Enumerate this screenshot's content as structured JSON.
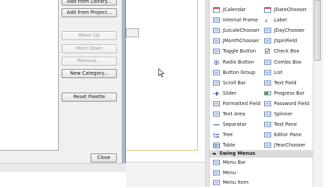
{
  "dialog": {
    "buttons": {
      "add_from_library": "Add from Library...",
      "add_from_project": "Add from Project...",
      "move_up": "Move Up",
      "move_down": "More Down",
      "remove": "Remove...",
      "new_category": "New Category...",
      "reset_palette": "Reset Palette",
      "close": "Close"
    }
  },
  "palette": {
    "items_left": [
      {
        "label": "JCalendar",
        "icon": "calendar-icon"
      },
      {
        "label": "Internal Frame",
        "icon": "internal-frame-icon"
      },
      {
        "label": "JLocaleChooser",
        "icon": "locale-chooser-icon"
      },
      {
        "label": "JMonthChooser",
        "icon": "month-chooser-icon"
      },
      {
        "label": "Toggle Button",
        "icon": "toggle-button-icon"
      },
      {
        "label": "Radio Button",
        "icon": "radio-button-icon"
      },
      {
        "label": "Button Group",
        "icon": "button-group-icon"
      },
      {
        "label": "Scroll Bar",
        "icon": "scroll-bar-icon"
      },
      {
        "label": "Slider",
        "icon": "slider-icon"
      },
      {
        "label": "Formatted Field",
        "icon": "formatted-field-icon"
      },
      {
        "label": "Text Area",
        "icon": "text-area-icon"
      },
      {
        "label": "Separator",
        "icon": "separator-icon"
      },
      {
        "label": "Tree",
        "icon": "tree-icon"
      },
      {
        "label": "Table",
        "icon": "table-icon"
      }
    ],
    "items_right": [
      {
        "label": "JDateChooser",
        "icon": "date-chooser-icon"
      },
      {
        "label": "Label",
        "icon": "label-icon"
      },
      {
        "label": "JDayChooser",
        "icon": "day-chooser-icon"
      },
      {
        "label": "JSpinField",
        "icon": "spin-field-icon"
      },
      {
        "label": "Check Box",
        "icon": "check-box-icon"
      },
      {
        "label": "Combo Box",
        "icon": "combo-box-icon"
      },
      {
        "label": "List",
        "icon": "list-icon"
      },
      {
        "label": "Text Field",
        "icon": "text-field-icon"
      },
      {
        "label": "Progress Bar",
        "icon": "progress-bar-icon"
      },
      {
        "label": "Password Field",
        "icon": "password-field-icon"
      },
      {
        "label": "Spinner",
        "icon": "spinner-icon"
      },
      {
        "label": "Text Pane",
        "icon": "text-pane-icon"
      },
      {
        "label": "Editor Pane",
        "icon": "editor-pane-icon"
      },
      {
        "label": "JYearChooser",
        "icon": "year-chooser-icon"
      }
    ],
    "section_title": "Swing Menus",
    "menu_items": [
      {
        "label": "Menu Bar",
        "icon": "menu-bar-icon"
      },
      {
        "label": "Menu",
        "icon": "menu-icon"
      },
      {
        "label": "Menu Item",
        "icon": "menu-item-icon"
      }
    ]
  },
  "colors": {
    "dialog_frame": "#a9b8c9",
    "form_border": "#e3c06a",
    "icon_blue": "#4a6ea9"
  }
}
